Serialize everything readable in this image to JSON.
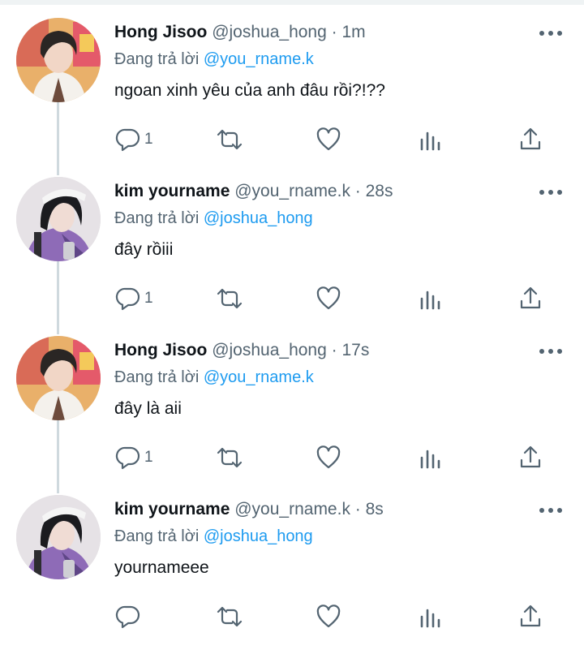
{
  "colors": {
    "accent": "#1d9bf0",
    "muted": "#536471",
    "text": "#0f1419",
    "thread_line": "#cfd9de"
  },
  "tweets": [
    {
      "name": "Hong Jisoo",
      "handle": "@joshua_hong",
      "dot": " · ",
      "time": "1m",
      "reply_prefix": "Đang trả lời ",
      "reply_to": "@you_rname.k",
      "text": "ngoan xinh yêu của anh đâu rồi?!??",
      "reply_count": "1",
      "avatar": "joshua-avatar"
    },
    {
      "name": "kim yourname",
      "handle": "@you_rname.k",
      "dot": " · ",
      "time": "28s",
      "reply_prefix": "Đang trả lời ",
      "reply_to": "@joshua_hong",
      "text": "đây rồiii",
      "reply_count": "1",
      "avatar": "yourname-avatar"
    },
    {
      "name": "Hong Jisoo",
      "handle": "@joshua_hong",
      "dot": " · ",
      "time": "17s",
      "reply_prefix": "Đang trả lời ",
      "reply_to": "@you_rname.k",
      "text": "đây là aii",
      "reply_count": "1",
      "avatar": "joshua-avatar"
    },
    {
      "name": "kim yourname",
      "handle": "@you_rname.k",
      "dot": " · ",
      "time": "8s",
      "reply_prefix": "Đang trả lời ",
      "reply_to": "@joshua_hong",
      "text": "yournameee",
      "reply_count": "",
      "avatar": "yourname-avatar"
    }
  ],
  "icons": {
    "reply": "comment-icon",
    "retweet": "retweet-icon",
    "like": "heart-icon",
    "views": "analytics-icon",
    "share": "share-icon",
    "more": "more-icon"
  }
}
